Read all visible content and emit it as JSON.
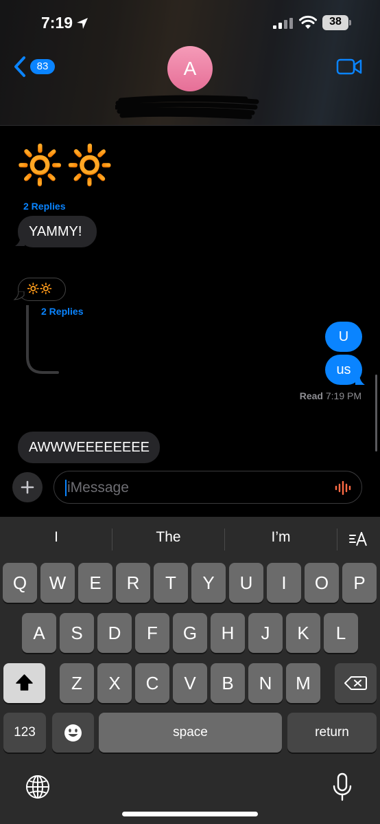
{
  "status_bar": {
    "time": "7:19",
    "battery": "38"
  },
  "header": {
    "back_count": "83",
    "avatar_initial": "A"
  },
  "messages": {
    "emoji_big": "🔆🔆",
    "replies_1": "2 Replies",
    "yammy": "YAMMY!",
    "emoji_small": "🔆🔆",
    "replies_2": "2 Replies",
    "out_1": "U",
    "out_2": "us",
    "read_label": "Read",
    "read_time": "7:19 PM",
    "aww": "AWWWEEEEEEEE"
  },
  "input": {
    "placeholder": "iMessage"
  },
  "keyboard": {
    "predictions": [
      "I",
      "The",
      "I’m"
    ],
    "row1": [
      "Q",
      "W",
      "E",
      "R",
      "T",
      "Y",
      "U",
      "I",
      "O",
      "P"
    ],
    "row2": [
      "A",
      "S",
      "D",
      "F",
      "G",
      "H",
      "J",
      "K",
      "L"
    ],
    "row3": [
      "Z",
      "X",
      "C",
      "V",
      "B",
      "N",
      "M"
    ],
    "numbers_label": "123",
    "space_label": "space",
    "return_label": "return"
  },
  "colors": {
    "accent": "#0a84ff",
    "incoming_bubble": "#262629",
    "key": "#6b6b6b",
    "keyboard_bg": "#2b2b2b"
  }
}
